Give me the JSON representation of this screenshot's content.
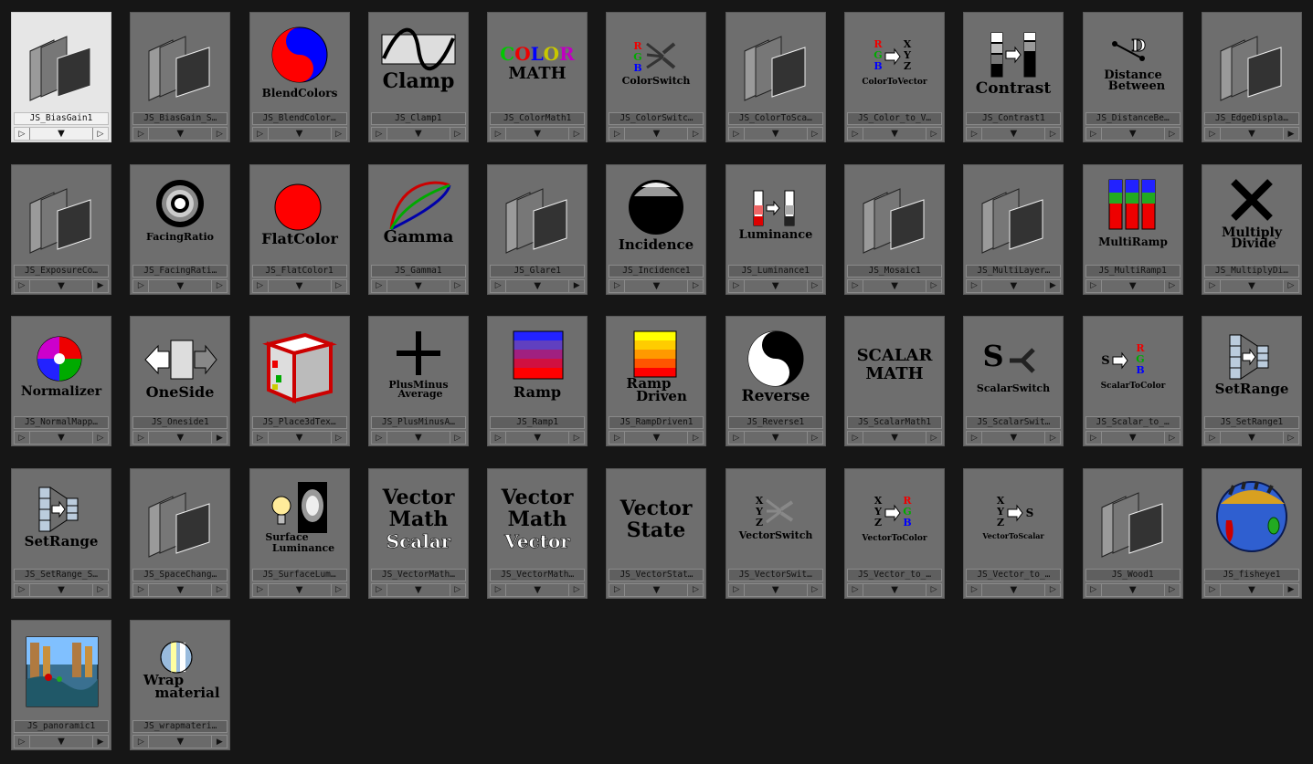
{
  "nodes": [
    {
      "label": "JS_BiasGain1",
      "icon": "layers-icon",
      "selected": true,
      "out": "hollow"
    },
    {
      "label": "JS_BiasGain_S…",
      "icon": "layers-icon",
      "out": "hollow"
    },
    {
      "label": "JS_BlendColor…",
      "icon": "blendcolors-icon",
      "caption": "BlendColors",
      "out": "hollow"
    },
    {
      "label": "JS_Clamp1",
      "icon": "clamp-icon",
      "caption": "Clamp",
      "out": "hollow"
    },
    {
      "label": "JS_ColorMath1",
      "icon": "colormath-icon",
      "caption": "MATH",
      "caption2": "COLOR",
      "out": "hollow"
    },
    {
      "label": "JS_ColorSwitc…",
      "icon": "colorswitch-icon",
      "caption": "ColorSwitch",
      "out": "hollow"
    },
    {
      "label": "JS_ColorToSca…",
      "icon": "layers-icon",
      "out": "hollow"
    },
    {
      "label": "JS_Color_to_V…",
      "icon": "colortovector-icon",
      "caption": "ColorToVector",
      "out": "hollow"
    },
    {
      "label": "JS_Contrast1",
      "icon": "contrast-icon",
      "caption": "Contrast",
      "out": "hollow"
    },
    {
      "label": "JS_DistanceBe…",
      "icon": "distance-icon",
      "caption": "Distance",
      "caption2": "Between",
      "out": "hollow"
    },
    {
      "label": "JS_EdgeDispla…",
      "icon": "layers-icon",
      "out": "filled"
    },
    {
      "label": "JS_ExposureCo…",
      "icon": "layers-icon",
      "out": "filled"
    },
    {
      "label": "JS_FacingRati…",
      "icon": "facingratio-icon",
      "caption": "FacingRatio",
      "out": "hollow"
    },
    {
      "label": "JS_FlatColor1",
      "icon": "flatcolor-icon",
      "caption": "FlatColor",
      "out": "hollow"
    },
    {
      "label": "JS_Gamma1",
      "icon": "gamma-icon",
      "caption": "Gamma",
      "out": "hollow"
    },
    {
      "label": "JS_Glare1",
      "icon": "layers-icon",
      "out": "filled"
    },
    {
      "label": "JS_Incidence1",
      "icon": "incidence-icon",
      "caption": "Incidence",
      "out": "hollow"
    },
    {
      "label": "JS_Luminance1",
      "icon": "luminance-icon",
      "caption": "Luminance",
      "out": "hollow"
    },
    {
      "label": "JS_Mosaic1",
      "icon": "layers-icon",
      "out": "hollow"
    },
    {
      "label": "JS_MultiLayer…",
      "icon": "layers-icon",
      "out": "filled"
    },
    {
      "label": "JS_MultiRamp1",
      "icon": "multiramp-icon",
      "caption": "MultiRamp",
      "out": "hollow"
    },
    {
      "label": "JS_MultiplyDi…",
      "icon": "multiply-icon",
      "caption": "Multiply",
      "caption2": "Divide",
      "out": "hollow"
    },
    {
      "label": "JS_NormalMapp…",
      "icon": "normalizer-icon",
      "caption": "Normalizer",
      "out": "hollow"
    },
    {
      "label": "JS_Oneside1",
      "icon": "oneside-icon",
      "caption": "OneSide",
      "out": "filled"
    },
    {
      "label": "JS_Place3dTex…",
      "icon": "place3d-icon",
      "out": "hollow"
    },
    {
      "label": "JS_PlusMinusA…",
      "icon": "plusminus-icon",
      "caption": "PlusMinus",
      "caption2": "Average",
      "out": "hollow"
    },
    {
      "label": "JS_Ramp1",
      "icon": "ramp-icon",
      "caption": "Ramp",
      "out": "hollow"
    },
    {
      "label": "JS_RampDriven1",
      "icon": "rampdriven-icon",
      "caption": "Ramp",
      "caption2": "Driven",
      "out": "hollow"
    },
    {
      "label": "JS_Reverse1",
      "icon": "yinyang-icon",
      "caption": "Reverse",
      "out": "hollow"
    },
    {
      "label": "JS_ScalarMath1",
      "icon": "scalarmath-icon",
      "caption": "SCALAR",
      "caption2": "MATH",
      "out": "hollow"
    },
    {
      "label": "JS_ScalarSwit…",
      "icon": "scalarswitch-icon",
      "caption": "ScalarSwitch",
      "out": "hollow"
    },
    {
      "label": "JS_Scalar_to_…",
      "icon": "scalartocolor-icon",
      "caption": "ScalarToColor",
      "out": "hollow"
    },
    {
      "label": "JS_SetRange1",
      "icon": "setrange-icon",
      "caption": "SetRange",
      "out": "hollow"
    },
    {
      "label": "JS_SetRange_S…",
      "icon": "setrange-icon",
      "caption": "SetRange",
      "out": "hollow"
    },
    {
      "label": "JS_SpaceChang…",
      "icon": "layers-icon",
      "out": "hollow"
    },
    {
      "label": "JS_SurfaceLum…",
      "icon": "surfacelum-icon",
      "caption": "Surface",
      "caption2": "Luminance",
      "out": "hollow"
    },
    {
      "label": "JS_VectorMath…",
      "icon": "vectormath-icon",
      "caption": "Vector",
      "caption2": "Math",
      "caption3": "Scalar",
      "out": "hollow"
    },
    {
      "label": "JS_VectorMath…",
      "icon": "vectormath-icon",
      "caption": "Vector",
      "caption2": "Math",
      "caption3": "Vector",
      "out": "hollow"
    },
    {
      "label": "JS_VectorStat…",
      "icon": "vectorstate-icon",
      "caption": "Vector",
      "caption2": "State",
      "out": "hollow"
    },
    {
      "label": "JS_VectorSwit…",
      "icon": "vectorswitch-icon",
      "caption": "VectorSwitch",
      "out": "hollow"
    },
    {
      "label": "JS_Vector_to_…",
      "icon": "vectortocolor-icon",
      "caption": "VectorToColor",
      "out": "hollow"
    },
    {
      "label": "JS_Vector_to_…",
      "icon": "vectortoscalar-icon",
      "caption": "VectorToScalar",
      "out": "hollow"
    },
    {
      "label": "JS_Wood1",
      "icon": "layers-icon",
      "out": "hollow"
    },
    {
      "label": "JS_fisheye1",
      "icon": "fisheye-icon",
      "out": "filled"
    },
    {
      "label": "JS_panoramic1",
      "icon": "panoramic-icon",
      "out": "filled"
    },
    {
      "label": "JS_wrapmateri…",
      "icon": "wrapmaterial-icon",
      "caption": "Wrap",
      "caption2": "material",
      "out": "filled"
    }
  ],
  "controls": {
    "input_glyph": "▷",
    "menu_glyph": "▼",
    "output_hollow": "▷",
    "output_filled": "▶"
  }
}
